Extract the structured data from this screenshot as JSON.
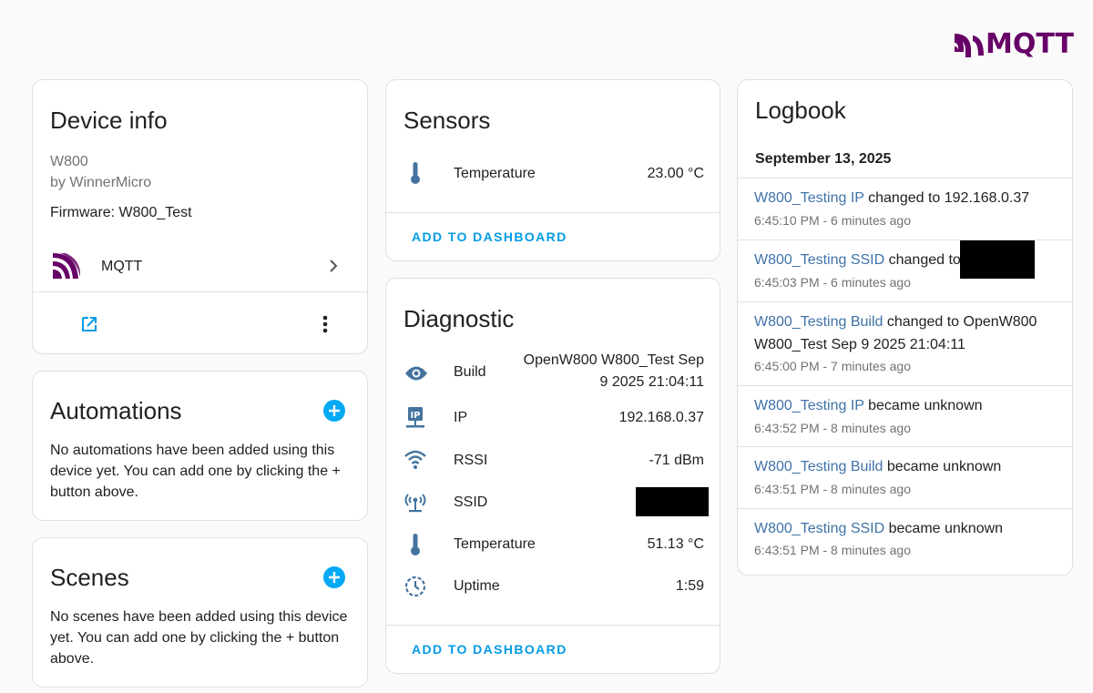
{
  "brand": {
    "text": "MQTT",
    "color": "#660066"
  },
  "device_info": {
    "title": "Device info",
    "model": "W800",
    "manufacturer": "by WinnerMicro",
    "firmware": "Firmware: W800_Test",
    "integration_label": "MQTT",
    "icons": {
      "integration": "mqtt-logo-icon",
      "chevron": "chevron-right-icon",
      "external": "open-in-new-icon",
      "menu": "dots-vertical-icon"
    }
  },
  "automations": {
    "title": "Automations",
    "text": "No automations have been added using this device yet. You can add one by clicking the + button above."
  },
  "scenes": {
    "title": "Scenes",
    "text": "No scenes have been added using this device yet. You can add one by clicking the + button above."
  },
  "sensors": {
    "title": "Sensors",
    "rows": [
      {
        "label": "Temperature",
        "value": "23.00 °C",
        "icon": "thermometer-icon"
      }
    ],
    "add_label": "ADD TO DASHBOARD"
  },
  "diagnostic": {
    "title": "Diagnostic",
    "rows": [
      {
        "label": "Build",
        "value_line1": "OpenW800 W800_Test Sep",
        "value_line2": "9 2025 21:04:11",
        "icon": "eye-icon"
      },
      {
        "label": "IP",
        "value": "192.168.0.37",
        "icon": "ip-network-icon"
      },
      {
        "label": "RSSI",
        "value": "-71 dBm",
        "icon": "wifi-icon"
      },
      {
        "label": "SSID",
        "value": "",
        "icon": "access-point-icon"
      },
      {
        "label": "Temperature",
        "value": "51.13 °C",
        "icon": "thermometer-icon"
      },
      {
        "label": "Uptime",
        "value": "1:59",
        "icon": "timer-outline-icon"
      }
    ],
    "add_label": "ADD TO DASHBOARD"
  },
  "logbook": {
    "title": "Logbook",
    "date": "September 13, 2025",
    "entries": [
      {
        "entity": "W800_Testing IP",
        "message": " changed to 192.168.0.37",
        "time": "6:45:10 PM - 6 minutes ago"
      },
      {
        "entity": "W800_Testing SSID",
        "message": " changed to",
        "time": "6:45:03 PM - 6 minutes ago"
      },
      {
        "entity": "W800_Testing Build",
        "message": " changed to OpenW800 W800_Test Sep 9 2025 21:04:11",
        "time": "6:45:00 PM - 7 minutes ago"
      },
      {
        "entity": "W800_Testing IP",
        "message": " became unknown",
        "time": "6:43:52 PM - 8 minutes ago"
      },
      {
        "entity": "W800_Testing Build",
        "message": " became unknown",
        "time": "6:43:51 PM - 8 minutes ago"
      },
      {
        "entity": "W800_Testing SSID",
        "message": " became unknown",
        "time": "6:43:51 PM - 8 minutes ago"
      }
    ]
  },
  "colors": {
    "accent": "#03a9f4",
    "link": "#3f72a8",
    "mqtt": "#660066"
  }
}
